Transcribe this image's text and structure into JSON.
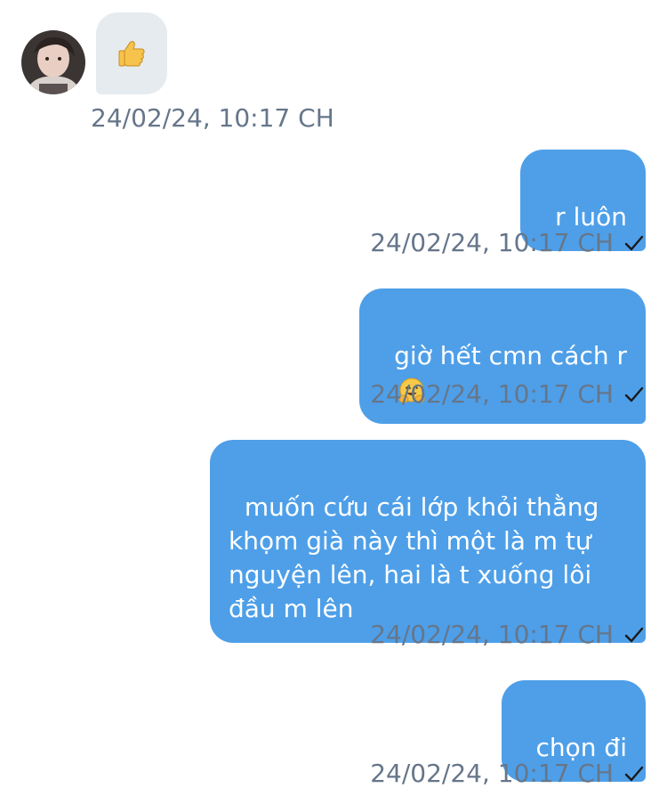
{
  "messages": [
    {
      "direction": "incoming",
      "content_icon": "thumbs-up-emoji",
      "timestamp": "24/02/24, 10:17 CH"
    },
    {
      "direction": "outgoing",
      "text": "r luôn",
      "timestamp": "24/02/24, 10:17 CH",
      "status_icon": "check-icon"
    },
    {
      "direction": "outgoing",
      "text": "giờ hết cmn cách r",
      "trailing_emoji": "hugging-face-emoji",
      "timestamp": "24/02/24, 10:17 CH",
      "status_icon": "check-icon"
    },
    {
      "direction": "outgoing",
      "text": "muốn cứu cái lớp khỏi thằng\nkhọm già này thì một là m tự\nnguyện lên, hai là t xuống lôi\nđầu m lên",
      "timestamp": "24/02/24, 10:17 CH",
      "status_icon": "check-icon"
    },
    {
      "direction": "outgoing",
      "text": "chọn đi",
      "timestamp": "24/02/24, 10:17 CH",
      "status_icon": "check-icon"
    }
  ],
  "colors": {
    "outgoing_bubble": "#4e9fe8",
    "incoming_bubble": "#e6ebf0",
    "timestamp": "#66768a",
    "background": "#ffffff"
  }
}
